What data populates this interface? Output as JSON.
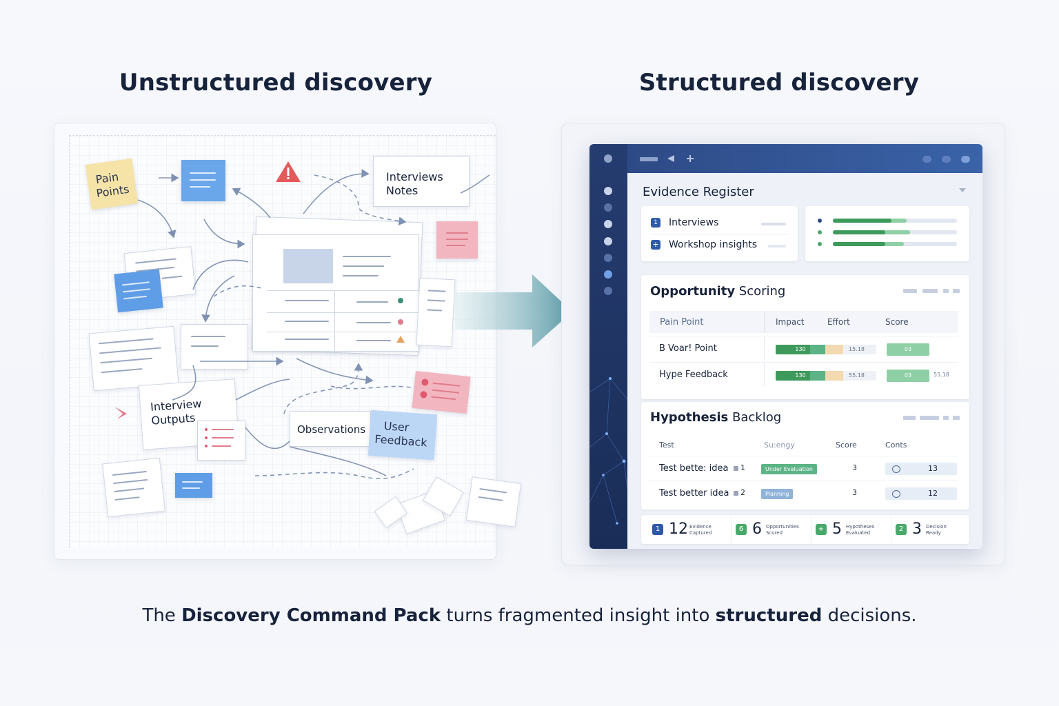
{
  "headings": {
    "left": "Unstructured discovery",
    "right": "Structured discovery"
  },
  "left_notes": {
    "pain_points": [
      "Pain",
      "Points"
    ],
    "interviews_notes": [
      "Interviews",
      "Notes"
    ],
    "interview_outputs": [
      "Interview",
      "Outputs"
    ],
    "observations": "Observations",
    "user_feedback": [
      "User",
      "Feedback"
    ]
  },
  "app": {
    "evidence_register": {
      "title": "Evidence Register",
      "items": [
        {
          "icon": "1",
          "label": "Interviews"
        },
        {
          "icon": "+",
          "label": "Workshop insights"
        }
      ],
      "progress": [
        {
          "dot": "#2e4a86",
          "fill": 0.47,
          "accent": 0.12
        },
        {
          "dot": "#4aa86a",
          "fill": 0.42,
          "accent": 0.2
        },
        {
          "dot": "#4aa86a",
          "fill": 0.42,
          "accent": 0.15
        }
      ]
    },
    "opportunity_scoring": {
      "title_bold": "Opportunity",
      "title_rest": " Scoring",
      "columns": [
        "Pain Point",
        "Impact",
        "Effort",
        "Score"
      ],
      "rows": [
        {
          "name": "B Voar! Point",
          "bar_label": "130",
          "effort": "15.18",
          "score": "03",
          "score_extra": ""
        },
        {
          "name": "Hype  Feedback",
          "bar_label": "130",
          "effort": "55.18",
          "score": "03",
          "score_extra": "55.18"
        }
      ]
    },
    "hypothesis_backlog": {
      "title_bold": "Hypothesis",
      "title_rest": " Backlog",
      "columns": [
        "Test",
        "Su:engy",
        "Score",
        "Conts"
      ],
      "rows": [
        {
          "name": "Test bette: idea",
          "num": "1",
          "status": "Under Evaluation",
          "status_color": "#5cb486",
          "score": "3",
          "count": "13"
        },
        {
          "name": "Test better idea",
          "num": "2",
          "status": "Planning",
          "status_color": "#8fb3d9",
          "score": "3",
          "count": "12"
        }
      ]
    },
    "stats": [
      {
        "icon": "1",
        "icon_color": "#2f5aa8",
        "value": "12",
        "label": [
          "Evidence",
          "Captured"
        ]
      },
      {
        "icon": "6",
        "icon_color": "#4aa86a",
        "value": "6",
        "label": [
          "Opportunities",
          "Scored"
        ]
      },
      {
        "icon": "+",
        "icon_color": "#4aa86a",
        "value": "5",
        "label": [
          "Hypotheses",
          "Evaluated"
        ]
      },
      {
        "icon": "2",
        "icon_color": "#4aa86a",
        "value": "3",
        "label": [
          "Decision",
          "Ready"
        ]
      }
    ]
  },
  "caption": {
    "part1": "The ",
    "bold1": "Discovery Command Pack",
    "part2": " turns fragmented insight into ",
    "bold2": "structured",
    "part3": " decisions."
  },
  "colors": {
    "navy": "#1f3462",
    "green": "#4aa86a",
    "sticky_yellow": "#f6e3a8",
    "sticky_blue": "#6aa6ea",
    "sticky_pink": "#f2b6c0",
    "arrow_teal": "#5d9ca8"
  }
}
